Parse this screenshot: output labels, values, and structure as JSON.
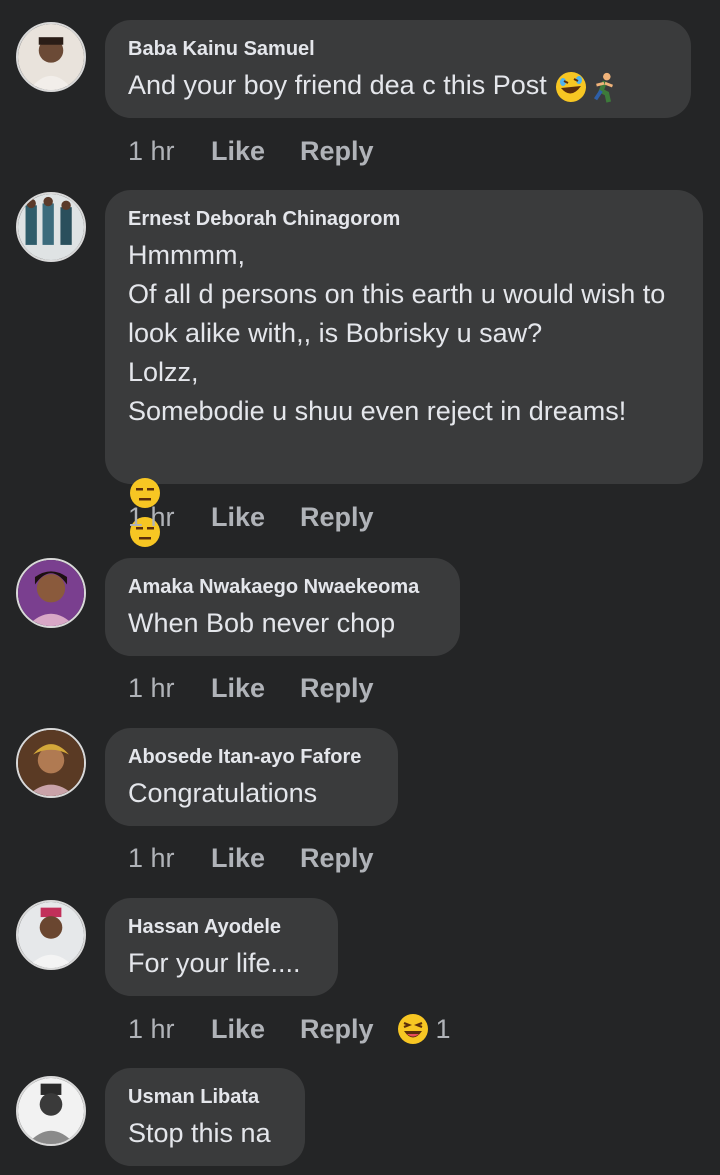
{
  "comments": [
    {
      "author": "Baba Kainu Samuel",
      "text": "And your boy friend dea c this Post",
      "time": "1 hr",
      "like_label": "Like",
      "reply_label": "Reply",
      "emojis": [
        "rofl-emoji",
        "running-man-emoji"
      ]
    },
    {
      "author": "Ernest Deborah Chinagorom",
      "text": "Hmmmm,\nOf all d persons on this earth u would wish to look alike with,, is Bobrisky u saw?\n Lolzz,\nSomebodie u shuu even reject in dreams!",
      "time": "1 hr",
      "like_label": "Like",
      "reply_label": "Reply",
      "emojis": [
        "expressionless-emoji",
        "expressionless-emoji"
      ]
    },
    {
      "author": "Amaka Nwakaego Nwaekeoma",
      "text": "When Bob never chop",
      "time": "1 hr",
      "like_label": "Like",
      "reply_label": "Reply"
    },
    {
      "author": "Abosede Itan-ayo Fafore",
      "text": "Congratulations",
      "time": "1 hr",
      "like_label": "Like",
      "reply_label": "Reply"
    },
    {
      "author": "Hassan Ayodele",
      "text": "For your life....",
      "time": "1 hr",
      "like_label": "Like",
      "reply_label": "Reply",
      "reaction": {
        "icon": "haha-reaction-icon",
        "count": "1"
      }
    },
    {
      "author": "Usman Libata",
      "text": "Stop this na"
    }
  ],
  "colors": {
    "background": "#242526",
    "bubble": "#3a3b3c",
    "text": "#e4e6eb",
    "secondary": "#b0b3b8"
  }
}
